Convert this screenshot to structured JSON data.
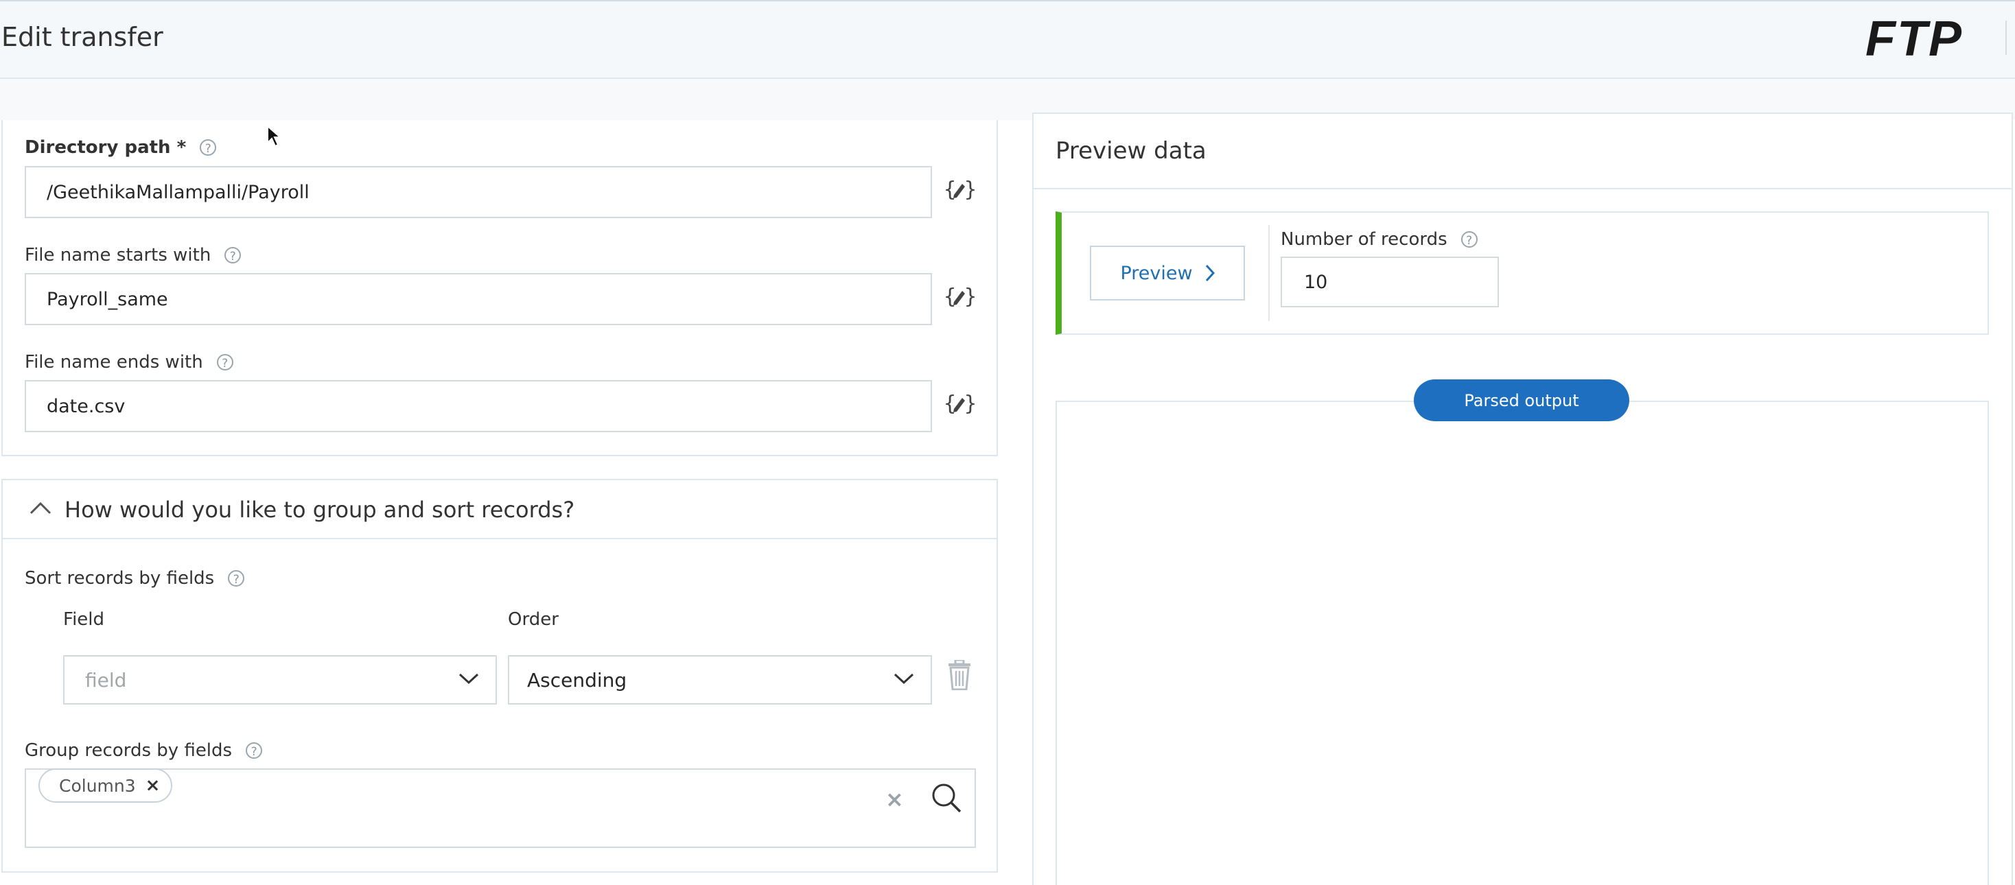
{
  "header": {
    "title": "Edit transfer",
    "logo": "FTP"
  },
  "file_source": {
    "directory_path": {
      "label": "Directory path *",
      "value": "/GeethikaMallampalli/Payroll"
    },
    "starts_with": {
      "label": "File name starts with",
      "value": "Payroll_same"
    },
    "ends_with": {
      "label": "File name ends with",
      "value": "date.csv"
    }
  },
  "group_sort": {
    "title": "How would you like to group and sort records?",
    "sort_label": "Sort records by fields",
    "field_header": "Field",
    "order_header": "Order",
    "field_placeholder": "field",
    "order_value": "Ascending",
    "group_label": "Group records by fields",
    "tags": [
      "Column3"
    ]
  },
  "preview": {
    "title": "Preview data",
    "button_label": "Preview",
    "records_label": "Number of records",
    "records_value": "10",
    "parsed_output_label": "Parsed output",
    "accent_color": "#4cb01c"
  },
  "icons": {
    "variable": "variable-edit-icon",
    "help": "help-icon",
    "chevron_up": "chevron-up-icon",
    "chevron_down": "chevron-down-icon",
    "trash": "trash-icon",
    "search": "search-icon",
    "clear": "clear-icon"
  },
  "help_glyph": "?",
  "tag_remove_glyph": "×",
  "clear_glyph": "×"
}
